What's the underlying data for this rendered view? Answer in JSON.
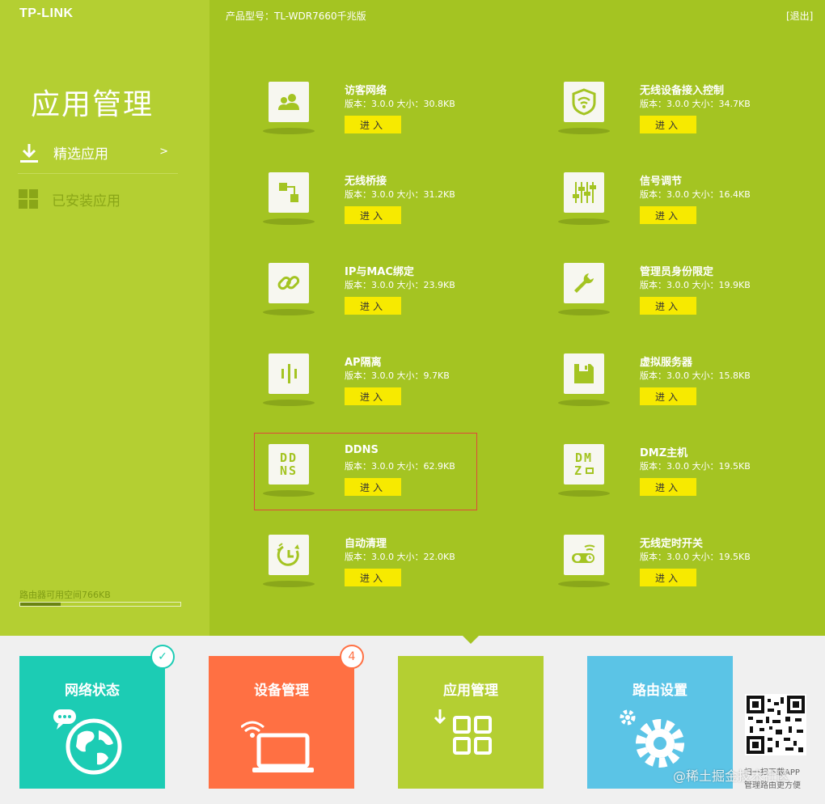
{
  "header": {
    "logo": "TP-LINK",
    "model": "产品型号：TL-WDR7660千兆版",
    "logout": "[退出]"
  },
  "sidebar": {
    "title": "应用管理",
    "items": [
      {
        "label": "精选应用",
        "arrow": ">"
      },
      {
        "label": "已安装应用"
      }
    ],
    "free_space": "路由器可用空间766KB",
    "space_fraction": 0.25
  },
  "enter_label": "进入",
  "apps": [
    {
      "name": "访客网络",
      "meta": "版本：3.0.0 大小：30.8KB"
    },
    {
      "name": "无线设备接入控制",
      "meta": "版本：3.0.0 大小：34.7KB"
    },
    {
      "name": "无线桥接",
      "meta": "版本：3.0.0 大小：31.2KB"
    },
    {
      "name": "信号调节",
      "meta": "版本：3.0.0 大小：16.4KB"
    },
    {
      "name": "IP与MAC绑定",
      "meta": "版本：3.0.0 大小：23.9KB"
    },
    {
      "name": "管理员身份限定",
      "meta": "版本：3.0.0 大小：19.9KB"
    },
    {
      "name": "AP隔离",
      "meta": "版本：3.0.0 大小：9.7KB"
    },
    {
      "name": "虚拟服务器",
      "meta": "版本：3.0.0 大小：15.8KB"
    },
    {
      "name": "DDNS",
      "meta": "版本：3.0.0 大小：62.9KB"
    },
    {
      "name": "DMZ主机",
      "meta": "版本：3.0.0 大小：19.5KB"
    },
    {
      "name": "自动清理",
      "meta": "版本：3.0.0 大小：22.0KB"
    },
    {
      "name": "无线定时开关",
      "meta": "版本：3.0.0 大小：19.5KB"
    }
  ],
  "icon_text": {
    "ddns_1": "DD",
    "ddns_2": "NS",
    "dmz_1": "DM",
    "dmz_2": "Z"
  },
  "tiles": [
    {
      "label": "网络状态",
      "badge": "✓"
    },
    {
      "label": "设备管理",
      "badge": "4"
    },
    {
      "label": "应用管理"
    },
    {
      "label": "路由设置"
    }
  ],
  "qr": {
    "line1": "扫一扫下载APP",
    "line2": "管理路由更方便"
  },
  "watermark": "@稀土掘金技术社区",
  "colors": {
    "accent": "#a4c422",
    "sidebar": "#b4cf32",
    "button": "#f7ea00",
    "tile_network": "#1cccb4",
    "tile_device": "#ff7043",
    "tile_settings": "#5bc4e6"
  }
}
